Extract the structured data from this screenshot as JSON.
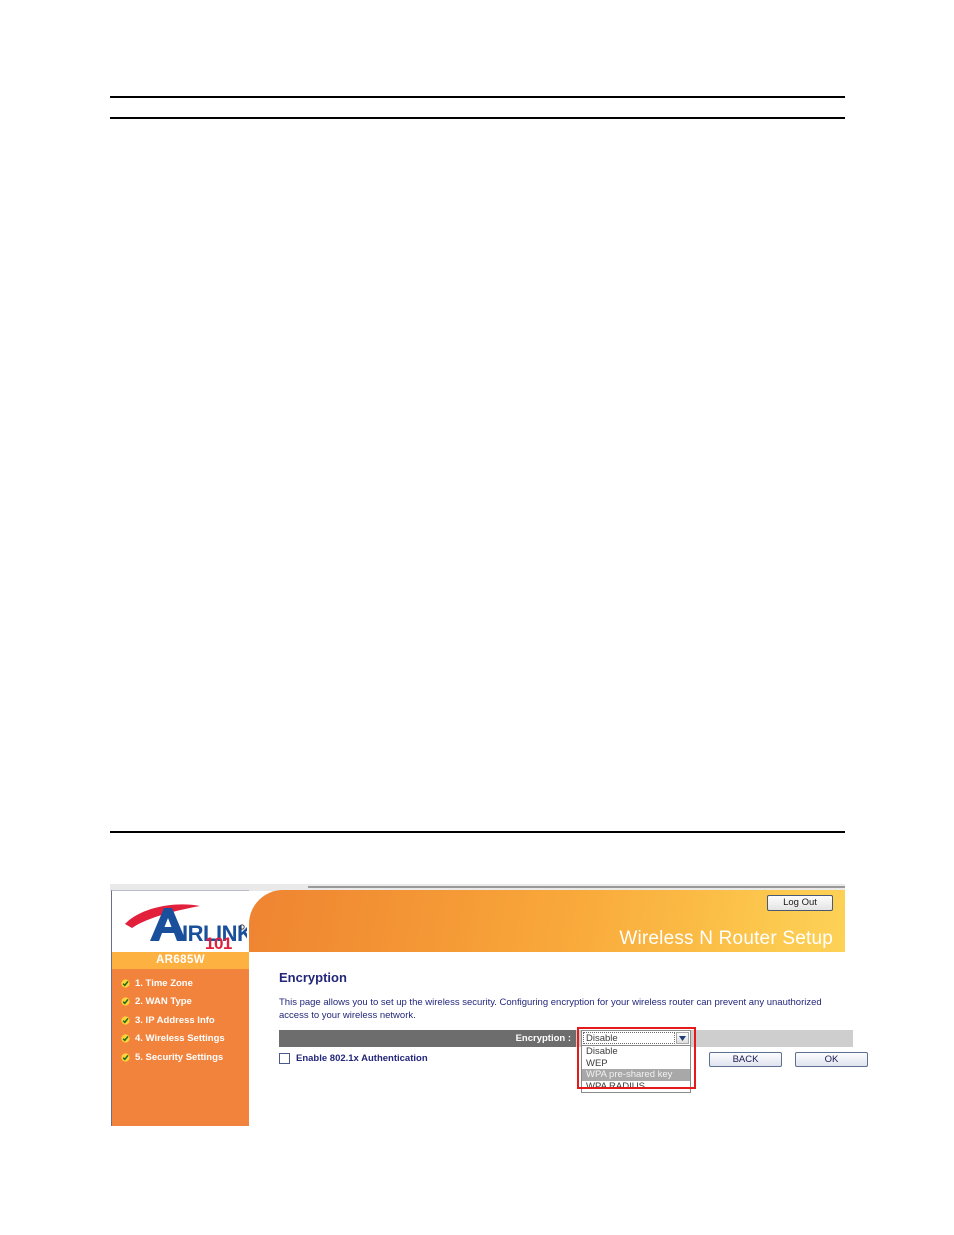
{
  "router_ui": {
    "logo": {
      "brand_primary": "AIRLINK",
      "brand_suffix": "101",
      "registered_mark": "®",
      "color_blue": "#1a4f9c",
      "color_red": "#e2203c"
    },
    "header": {
      "title": "Wireless N Router Setup",
      "logout_label": "Log Out"
    },
    "sidebar": {
      "model": "AR685W",
      "items": [
        {
          "label": "1. Time Zone"
        },
        {
          "label": "2. WAN Type"
        },
        {
          "label": "3. IP Address Info"
        },
        {
          "label": "4. Wireless Settings"
        },
        {
          "label": "5. Security Settings"
        }
      ],
      "background_color": "#f2833c",
      "model_bar_color": "#fdb141"
    },
    "content": {
      "title": "Encryption",
      "description": "This page allows you to set up the wireless security. Configuring encryption for your wireless router can prevent any unauthorized access to your wireless network.",
      "encryption_label": "Encryption :",
      "encryption_value": "Disable",
      "encryption_options": [
        "Disable",
        "WEP",
        "WPA pre-shared key",
        "WPA RADIUS"
      ],
      "encryption_highlighted_option": "WPA pre-shared key",
      "checkbox_label": "Enable 802.1x Authentication",
      "checkbox_checked": false,
      "buttons": [
        {
          "label": "BACK"
        },
        {
          "label": "OK"
        }
      ],
      "annotation_color": "#e51b1b"
    }
  }
}
